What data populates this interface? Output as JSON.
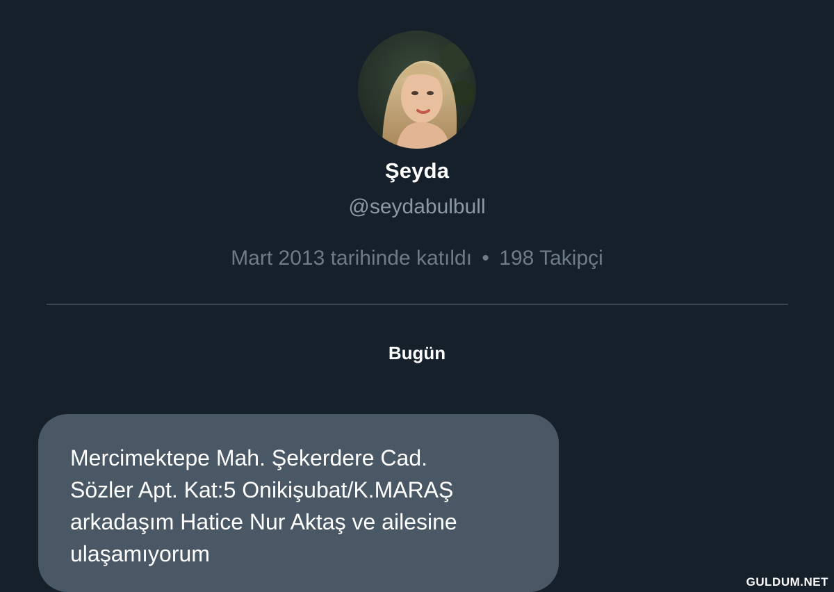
{
  "profile": {
    "display_name": "Şeyda",
    "handle": "@seydabulbull",
    "joined": "Mart 2013 tarihinde katıldı",
    "separator": "•",
    "followers": "198 Takipçi"
  },
  "conversation": {
    "day_label": "Bugün",
    "message": "Mercimektepe Mah. Şekerdere Cad.\nSözler Apt. Kat:5  Onikişubat/K.MARAŞ\narkadaşım Hatice Nur Aktaş ve ailesine\nulaşamıyorum"
  },
  "watermark": "GULDUM.NET",
  "colors": {
    "background": "#15202b",
    "bubble": "#4a5866",
    "divider": "#38444d",
    "secondary_text": "#8b98a5"
  }
}
